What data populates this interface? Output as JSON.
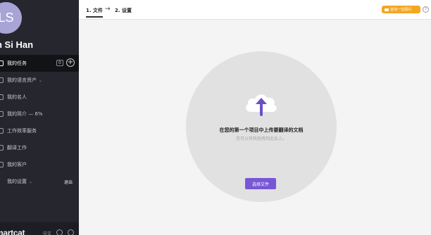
{
  "user": {
    "initials": "LS",
    "name": "n Si Han"
  },
  "sidebar": {
    "items": [
      {
        "label": "我的任务",
        "badge": "0",
        "add": "+"
      },
      {
        "label": "我的语言资产",
        "caret": "⌄"
      },
      {
        "label": "我的名人"
      },
      {
        "label": "我的简介 — 6%"
      },
      {
        "label": "工作效率服务"
      },
      {
        "label": "翻译工作"
      },
      {
        "label": "我的客户"
      },
      {
        "label": "我的设置",
        "caret": "⌄",
        "action": "退出"
      }
    ],
    "brand": "martcat",
    "language": "中文"
  },
  "topbar": {
    "step1": "1. 文件",
    "arrow": "→",
    "step2": "2. 设置",
    "promo": "咨询一位顾问",
    "help": "?"
  },
  "upload": {
    "title": "在您的第一个项目中上传要翻译的文档",
    "subtitle": "您可以将其拖拽到此处上。",
    "button": "选择文件"
  },
  "colors": {
    "accent": "#7757d6",
    "sidebar": "#26262e",
    "promo": "#f5a623",
    "avatar": "#a9a4d6"
  }
}
